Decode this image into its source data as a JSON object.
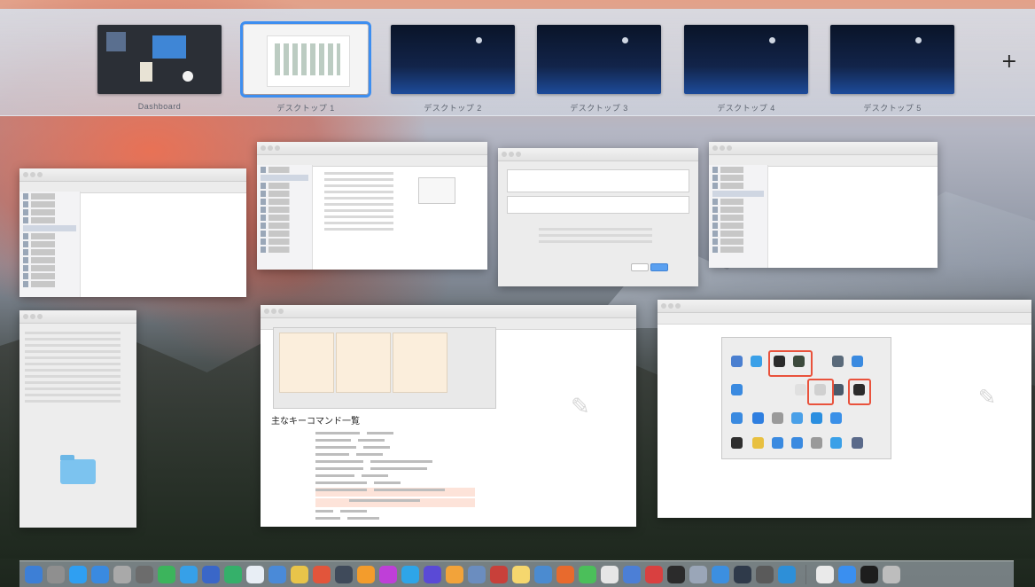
{
  "spaces": [
    {
      "label": "Dashboard"
    },
    {
      "label": "デスクトップ 1"
    },
    {
      "label": "デスクトップ 2"
    },
    {
      "label": "デスクトップ 3"
    },
    {
      "label": "デスクトップ 4"
    },
    {
      "label": "デスクトップ 5"
    }
  ],
  "add_space_label": "+",
  "document": {
    "title": "主なキーコマンド一覧"
  },
  "dock": {
    "app_colors": [
      "#3d7fd6",
      "#8f8f8f",
      "#2f9ff2",
      "#3a8ae0",
      "#a9a9a9",
      "#6c6c6c",
      "#3cb45c",
      "#36a0e8",
      "#3a67c8",
      "#35b06a",
      "#e8eef5",
      "#4a8ad8",
      "#e8c44a",
      "#e2553b",
      "#3f4a5a",
      "#f39c2c",
      "#bf3fd8",
      "#2ea5e8",
      "#5a4ad6",
      "#f2a33a",
      "#6b8dbf",
      "#c8403a",
      "#f5d76e",
      "#4b8bd0",
      "#e86a2d",
      "#4bbf5a",
      "#e6e6e6",
      "#4c7fd6",
      "#d94040",
      "#2b2b2b",
      "#9aa6b8",
      "#3c8fe0",
      "#2f3a4a",
      "#5a5a5a",
      "#2d8fd8"
    ],
    "trailing_colors": [
      "#eaeaea",
      "#3a8ff0",
      "#1d1d1d",
      "#bdbdbd"
    ]
  }
}
